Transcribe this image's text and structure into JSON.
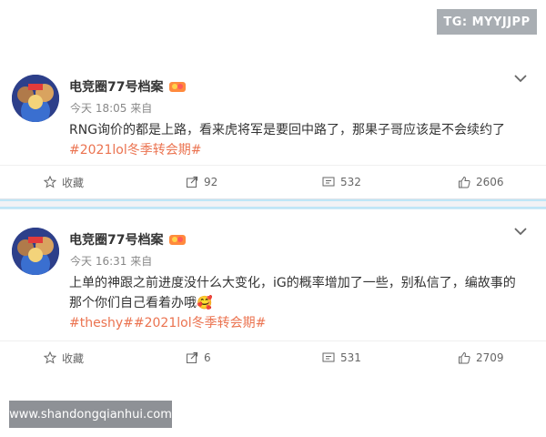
{
  "watermarks": {
    "top": "TG: MYYJJPP",
    "bottom": "www.shandongqianhui.com"
  },
  "posts": [
    {
      "author": "电竞圈77号档案",
      "time": "今天 18:05 来自",
      "content": "RNG询价的都是上路，看来虎将军是要回中路了，那果子哥应该是不会续约了",
      "topic": "#2021lol冬季转会期#",
      "actions": {
        "favorite": "收藏",
        "forward_count": "92",
        "comment_count": "532",
        "like_count": "2606"
      }
    },
    {
      "author": "电竞圈77号档案",
      "time": "今天 16:31 来自",
      "content_line1": "上单的神跟之前进度没什么大变化，iG的概率增加了一些，别私信了，编故事的",
      "content_line2": "那个你们自己看着办哦🥰",
      "topic": "#theshy##2021lol冬季转会期#",
      "actions": {
        "favorite": "收藏",
        "forward_count": "6",
        "comment_count": "531",
        "like_count": "2709"
      }
    }
  ],
  "colors": {
    "topic": "#eb7350",
    "text": "#333333",
    "meta": "#888888",
    "separator": "#bfe6f7"
  }
}
